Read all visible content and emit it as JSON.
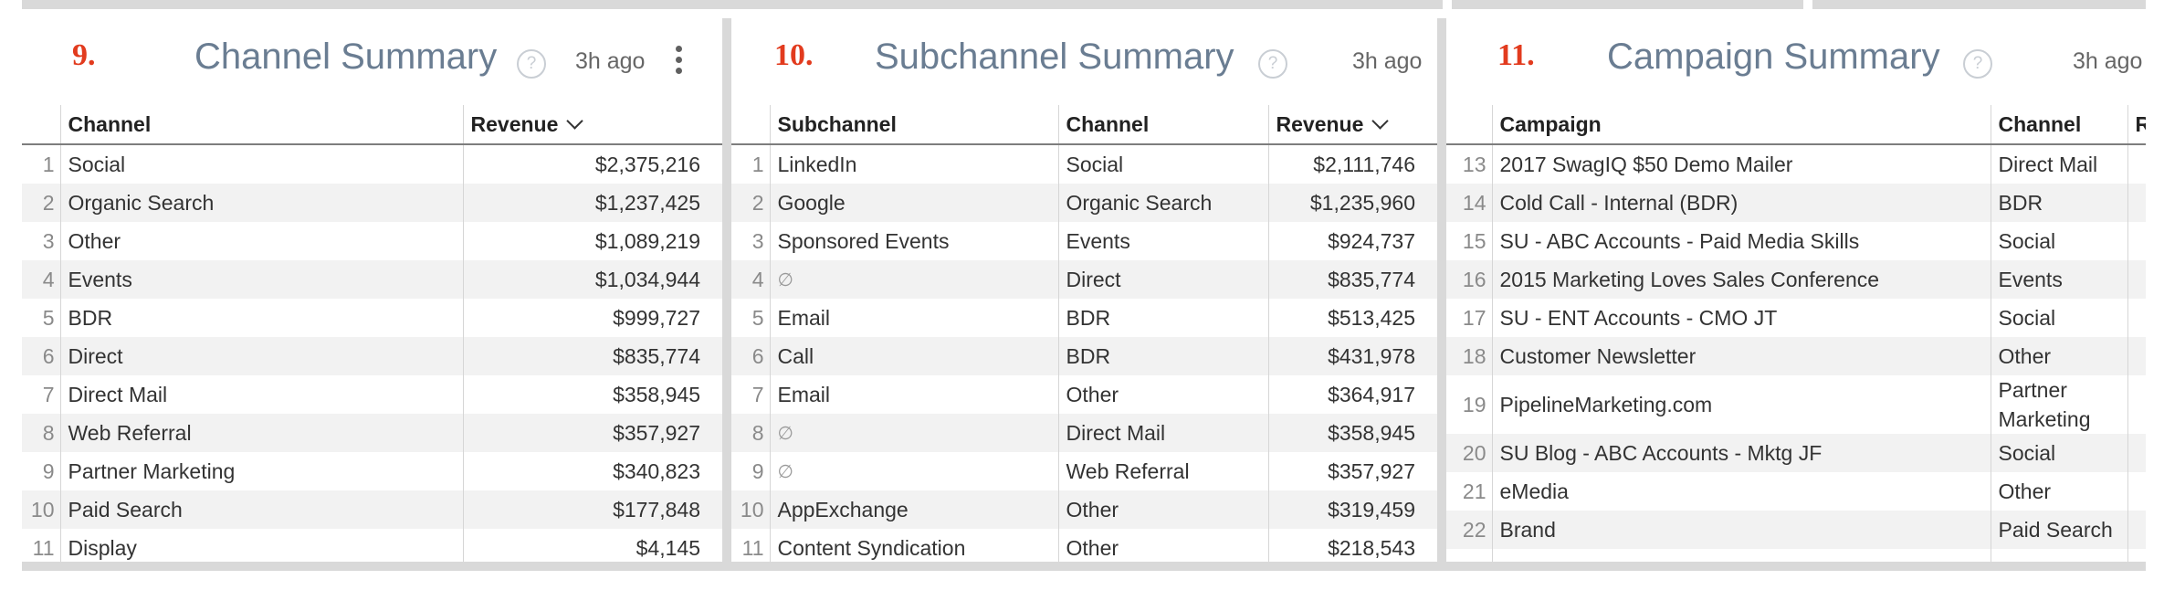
{
  "tiles": [
    {
      "number": "9.",
      "title": "Channel Summary",
      "help": "?",
      "updated": "3h ago",
      "columns": [
        "Channel",
        "Revenue"
      ],
      "rows": [
        {
          "n": "1",
          "channel": "Social",
          "revenue": "$2,375,216"
        },
        {
          "n": "2",
          "channel": "Organic Search",
          "revenue": "$1,237,425"
        },
        {
          "n": "3",
          "channel": "Other",
          "revenue": "$1,089,219"
        },
        {
          "n": "4",
          "channel": "Events",
          "revenue": "$1,034,944"
        },
        {
          "n": "5",
          "channel": "BDR",
          "revenue": "$999,727"
        },
        {
          "n": "6",
          "channel": "Direct",
          "revenue": "$835,774"
        },
        {
          "n": "7",
          "channel": "Direct Mail",
          "revenue": "$358,945"
        },
        {
          "n": "8",
          "channel": "Web Referral",
          "revenue": "$357,927"
        },
        {
          "n": "9",
          "channel": "Partner Marketing",
          "revenue": "$340,823"
        },
        {
          "n": "10",
          "channel": "Paid Search",
          "revenue": "$177,848"
        },
        {
          "n": "11",
          "channel": "Display",
          "revenue": "$4,145"
        }
      ]
    },
    {
      "number": "10.",
      "title": "Subchannel Summary",
      "help": "?",
      "updated": "3h ago",
      "columns": [
        "Subchannel",
        "Channel",
        "Revenue"
      ],
      "rows": [
        {
          "n": "1",
          "subchannel": "LinkedIn",
          "channel": "Social",
          "revenue": "$2,111,746"
        },
        {
          "n": "2",
          "subchannel": "Google",
          "channel": "Organic Search",
          "revenue": "$1,235,960"
        },
        {
          "n": "3",
          "subchannel": "Sponsored Events",
          "channel": "Events",
          "revenue": "$924,737"
        },
        {
          "n": "4",
          "subchannel": "∅",
          "channel": "Direct",
          "revenue": "$835,774"
        },
        {
          "n": "5",
          "subchannel": "Email",
          "channel": "BDR",
          "revenue": "$513,425"
        },
        {
          "n": "6",
          "subchannel": "Call",
          "channel": "BDR",
          "revenue": "$431,978"
        },
        {
          "n": "7",
          "subchannel": "Email",
          "channel": "Other",
          "revenue": "$364,917"
        },
        {
          "n": "8",
          "subchannel": "∅",
          "channel": "Direct Mail",
          "revenue": "$358,945"
        },
        {
          "n": "9",
          "subchannel": "∅",
          "channel": "Web Referral",
          "revenue": "$357,927"
        },
        {
          "n": "10",
          "subchannel": "AppExchange",
          "channel": "Other",
          "revenue": "$319,459"
        },
        {
          "n": "11",
          "subchannel": "Content Syndication",
          "channel": "Other",
          "revenue": "$218,543"
        }
      ]
    },
    {
      "number": "11.",
      "title": "Campaign Summary",
      "help": "?",
      "updated": "3h ago",
      "columns": [
        "Campaign",
        "Channel",
        "Re"
      ],
      "rows": [
        {
          "n": "13",
          "campaign": "2017 SwagIQ $50 Demo Mailer",
          "channel": "Direct Mail"
        },
        {
          "n": "14",
          "campaign": "Cold Call - Internal (BDR)",
          "channel": "BDR"
        },
        {
          "n": "15",
          "campaign": "SU - ABC Accounts - Paid Media Skills",
          "channel": "Social"
        },
        {
          "n": "16",
          "campaign": "2015 Marketing Loves Sales Conference",
          "channel": "Events"
        },
        {
          "n": "17",
          "campaign": "SU - ENT Accounts - CMO JT",
          "channel": "Social"
        },
        {
          "n": "18",
          "campaign": "Customer Newsletter",
          "channel": "Other"
        },
        {
          "n": "19",
          "campaign": "PipelineMarketing.com",
          "channel": "Partner Marketing"
        },
        {
          "n": "20",
          "campaign": "SU Blog - ABC Accounts - Mktg JF",
          "channel": "Social"
        },
        {
          "n": "21",
          "campaign": "eMedia",
          "channel": "Other"
        },
        {
          "n": "22",
          "campaign": "Brand",
          "channel": "Paid Search"
        },
        {
          "n": "",
          "campaign": "",
          "channel": ""
        }
      ]
    }
  ]
}
